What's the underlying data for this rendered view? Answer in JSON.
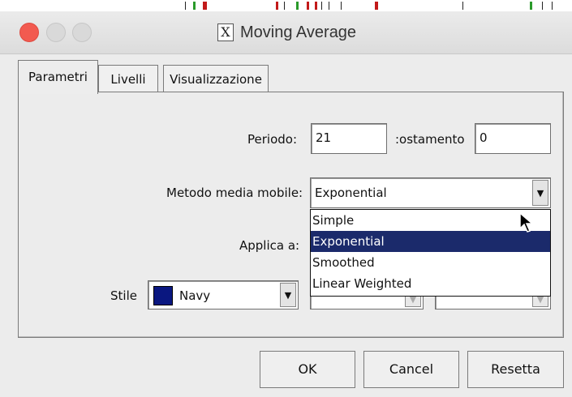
{
  "window": {
    "title": "Moving Average",
    "app_icon": "X"
  },
  "tabs": [
    {
      "label": "Parametri",
      "active": true
    },
    {
      "label": "Livelli",
      "active": false
    },
    {
      "label": "Visualizzazione",
      "active": false
    }
  ],
  "params": {
    "periodo_label": "Periodo:",
    "periodo_value": "21",
    "spostamento_label": ":ostamento",
    "spostamento_value": "0",
    "metodo_label": "Metodo media mobile:",
    "metodo_value": "Exponential",
    "applica_label": "Applica a:",
    "stile_label": "Stile",
    "stile_color_name": "Navy",
    "stile_color": "#0a1780"
  },
  "dropdown": {
    "options": [
      "Simple",
      "Exponential",
      "Smoothed",
      "Linear Weighted"
    ],
    "selected": "Exponential"
  },
  "buttons": {
    "ok": "OK",
    "cancel": "Cancel",
    "reset": "Resetta"
  },
  "colors": {
    "close_light": "#f25a50",
    "selection": "#1b2a6b"
  }
}
